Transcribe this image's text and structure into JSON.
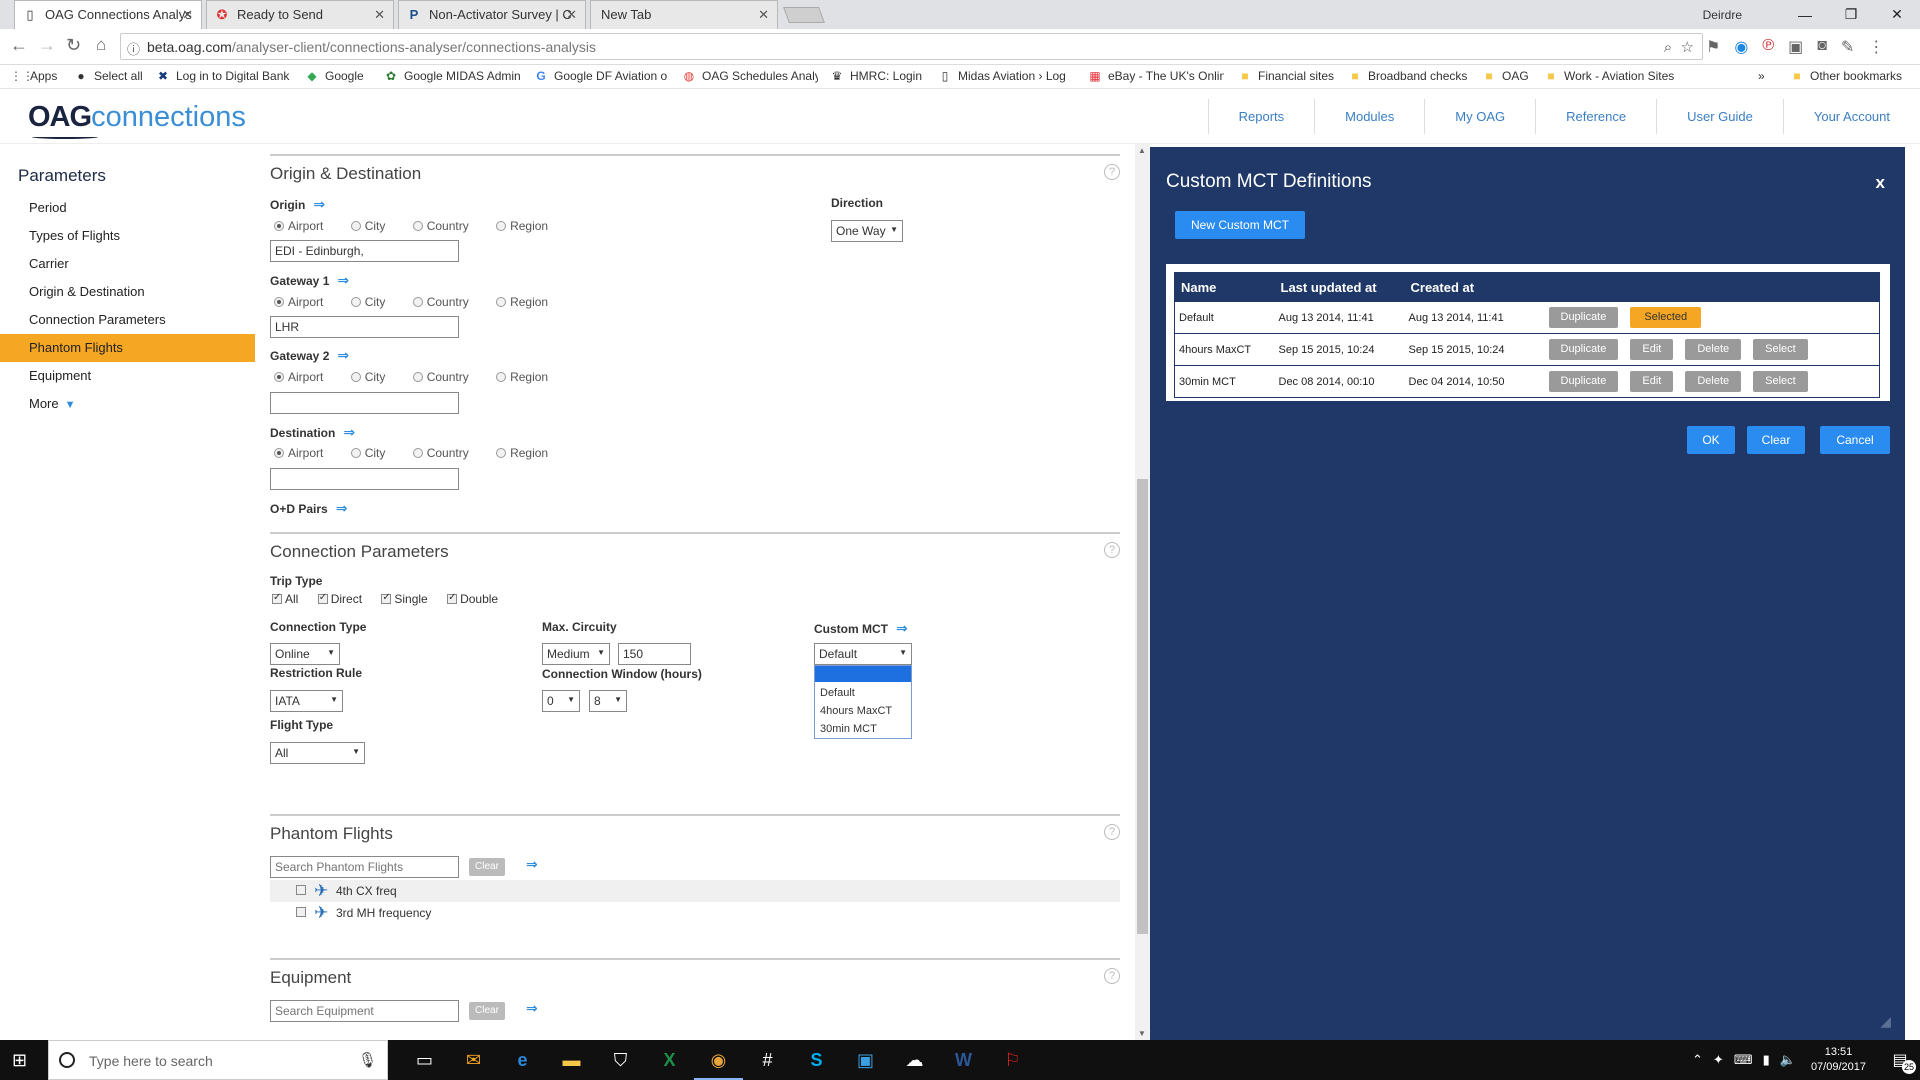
{
  "browser": {
    "tabs": [
      {
        "title": "OAG Connections Analys",
        "favicon": "page-icon",
        "active": true
      },
      {
        "title": "Ready to Send",
        "favicon": "lifebuoy-icon",
        "active": false
      },
      {
        "title": "Non-Activator Survey | C",
        "favicon": "p-icon",
        "active": false
      },
      {
        "title": "New Tab",
        "favicon": "",
        "active": false
      }
    ],
    "user": "Deirdre",
    "url_host": "beta.oag.com",
    "url_path": "/analyser-client/connections-analyser/connections-analysis",
    "bookmarks": [
      {
        "label": "Apps",
        "icon": "apps-icon"
      },
      {
        "label": "Select all",
        "icon": "circle-icon"
      },
      {
        "label": "Log in to Digital Bank",
        "icon": "cross-icon"
      },
      {
        "label": "Google",
        "icon": "map-icon"
      },
      {
        "label": "Google MIDAS Admin",
        "icon": "leaf-icon"
      },
      {
        "label": "Google DF Aviation o",
        "icon": "g-icon"
      },
      {
        "label": "OAG Schedules Analy",
        "icon": "chrome-icon"
      },
      {
        "label": "HMRC: Login",
        "icon": "crown-icon"
      },
      {
        "label": "Midas Aviation › Log",
        "icon": "doc-icon"
      },
      {
        "label": "eBay - The UK's Onlin",
        "icon": "ebay-icon"
      },
      {
        "label": "Financial sites",
        "icon": "folder-icon"
      },
      {
        "label": "Broadband checks",
        "icon": "folder-icon"
      },
      {
        "label": "OAG",
        "icon": "folder-icon"
      },
      {
        "label": "Work - Aviation Sites",
        "icon": "folder-icon"
      }
    ],
    "more_bookmarks": "»",
    "other_bookmarks": "Other bookmarks"
  },
  "header": {
    "logo_bold": "OAG",
    "logo_light": "connections",
    "nav": [
      "Reports",
      "Modules",
      "My OAG",
      "Reference",
      "User Guide",
      "Your Account"
    ]
  },
  "sidebar": {
    "title": "Parameters",
    "items": [
      {
        "label": "Period",
        "active": false
      },
      {
        "label": "Types of Flights",
        "active": false
      },
      {
        "label": "Carrier",
        "active": false
      },
      {
        "label": "Origin & Destination",
        "active": false
      },
      {
        "label": "Connection Parameters",
        "active": false
      },
      {
        "label": "Phantom Flights",
        "active": true
      },
      {
        "label": "Equipment",
        "active": false
      }
    ],
    "more": "More"
  },
  "od": {
    "title": "Origin & Destination",
    "help": "?",
    "radio_labels": [
      "Airport",
      "City",
      "Country",
      "Region"
    ],
    "origin": {
      "label": "Origin",
      "value": "EDI - Edinburgh,"
    },
    "gateway1": {
      "label": "Gateway 1",
      "value": "LHR"
    },
    "gateway2": {
      "label": "Gateway 2",
      "value": ""
    },
    "destination": {
      "label": "Destination",
      "value": ""
    },
    "od_pairs": "O+D Pairs",
    "direction": {
      "label": "Direction",
      "value": "One Way"
    }
  },
  "cp": {
    "title": "Connection Parameters",
    "help": "?",
    "trip_type": {
      "label": "Trip Type",
      "options": [
        "All",
        "Direct",
        "Single",
        "Double"
      ]
    },
    "connection_type": {
      "label": "Connection Type",
      "value": "Online"
    },
    "max_circuity": {
      "label": "Max. Circuity",
      "level": "Medium",
      "value": "150"
    },
    "custom_mct": {
      "label": "Custom MCT",
      "value": "Default",
      "options": [
        "",
        "Default",
        "4hours MaxCT",
        "30min MCT"
      ]
    },
    "restriction_rule": {
      "label": "Restriction Rule",
      "value": "IATA"
    },
    "connection_window": {
      "label": "Connection Window (hours)",
      "min": "0",
      "max": "8"
    },
    "flight_type": {
      "label": "Flight Type",
      "value": "All"
    }
  },
  "phantom": {
    "title": "Phantom Flights",
    "help": "?",
    "search_placeholder": "Search Phantom Flights",
    "clear": "Clear",
    "items": [
      "4th CX freq",
      "3rd MH frequency"
    ]
  },
  "equipment": {
    "title": "Equipment",
    "help": "?",
    "search_placeholder": "Search Equipment",
    "clear": "Clear"
  },
  "mct_panel": {
    "title": "Custom MCT Definitions",
    "close": "x",
    "new_button": "New Custom MCT",
    "columns": [
      "Name",
      "Last updated at",
      "Created at"
    ],
    "rows": [
      {
        "name": "Default",
        "updated": "Aug 13 2014, 11:41",
        "created": "Aug 13 2014, 11:41",
        "selected": true
      },
      {
        "name": "4hours MaxCT",
        "updated": "Sep 15 2015, 10:24",
        "created": "Sep 15 2015, 10:24",
        "selected": false
      },
      {
        "name": "30min MCT",
        "updated": "Dec 08 2014, 00:10",
        "created": "Dec 04 2014, 10:50",
        "selected": false
      }
    ],
    "btn_duplicate": "Duplicate",
    "btn_selected": "Selected",
    "btn_edit": "Edit",
    "btn_delete": "Delete",
    "btn_select": "Select",
    "ok": "OK",
    "clear": "Clear",
    "cancel": "Cancel"
  },
  "taskbar": {
    "search_placeholder": "Type here to search",
    "time": "13:51",
    "date": "07/09/2017",
    "notifications": "25"
  },
  "colors": {
    "accent_orange": "#f5a623",
    "panel_navy": "#1f3867",
    "button_blue": "#2a8cf0",
    "link_blue": "#3a7fc4"
  }
}
